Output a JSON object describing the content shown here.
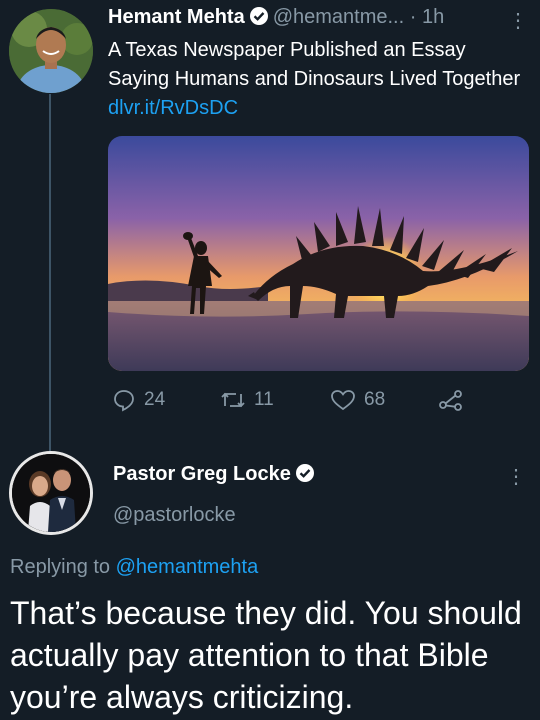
{
  "tweet1": {
    "author_name": "Hemant Mehta",
    "handle": "@hemantme...",
    "time": "· 1h",
    "text": "A Texas Newspaper Published an Essay Saying Humans and Dinosaurs Lived Together",
    "link": "dlvr.it/RvDsDC",
    "media_icon": "dinosaur-sunset-photo",
    "actions": {
      "replies": "24",
      "retweets": "11",
      "likes": "68"
    }
  },
  "tweet2": {
    "author_name": "Pastor Greg Locke",
    "handle": "@pastorlocke",
    "replying_prefix": "Replying to",
    "replying_to": "@hemantmehta",
    "text": "That’s because they did. You should actually pay attention to that Bible you’re always criticizing."
  },
  "colors": {
    "background": "#141d26",
    "link": "#1da1f2",
    "muted": "#8899a6"
  }
}
